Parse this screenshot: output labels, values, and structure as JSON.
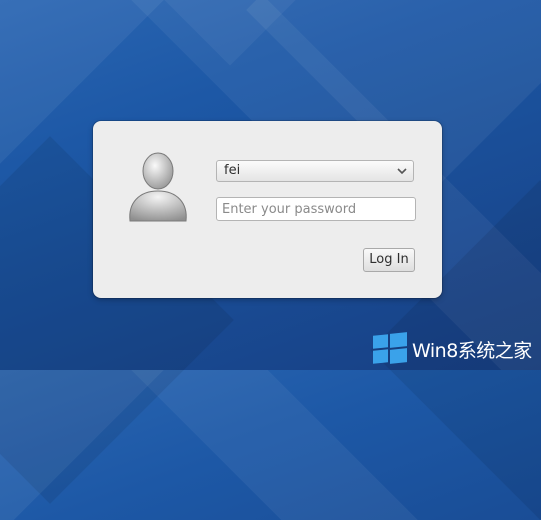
{
  "login": {
    "user_select": {
      "selected": "fei"
    },
    "password": {
      "placeholder": "Enter your password",
      "value": ""
    },
    "login_button": "Log In"
  },
  "watermark": {
    "text": "Win8系统之家"
  },
  "icons": [
    "user-avatar-icon",
    "chevron-down-icon",
    "windows-logo-icon"
  ],
  "colors": {
    "desktop_blue": "#1d58a6",
    "dialog_bg": "#ededed",
    "watermark_logo": "#3aa2ea"
  }
}
